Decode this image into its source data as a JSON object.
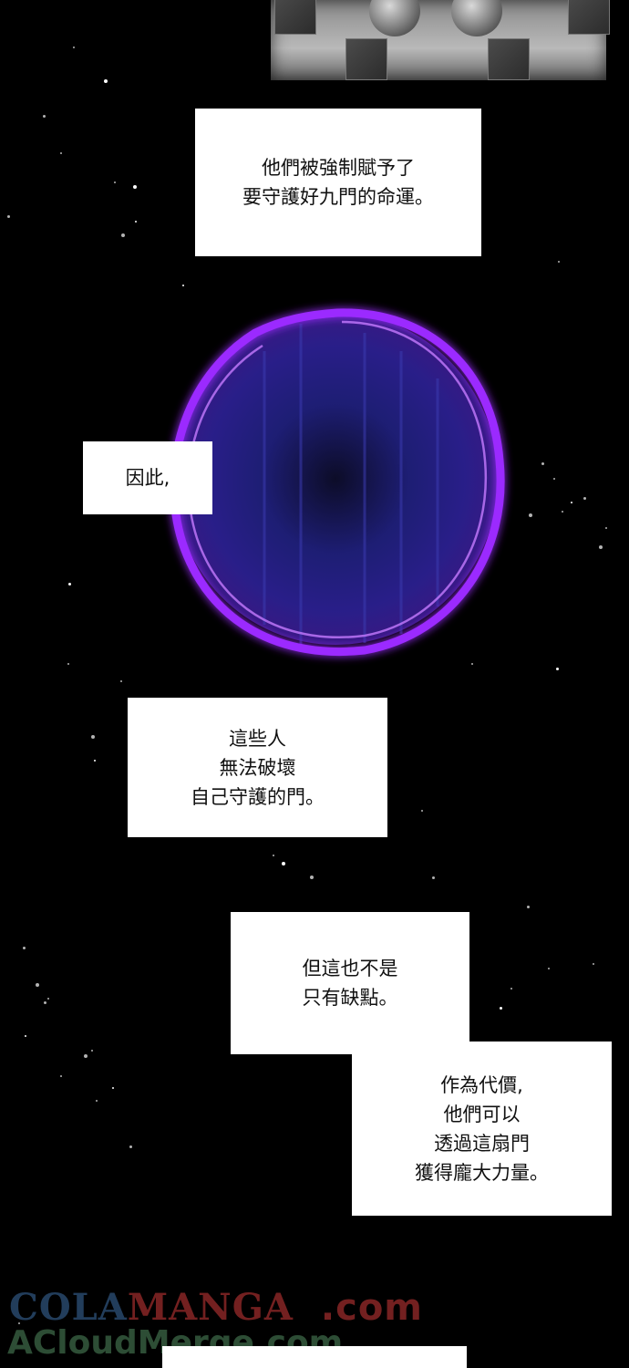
{
  "bubbles": {
    "b1": "他們被強制賦予了\n要守護好九門的命運。",
    "b2": "因此,",
    "b3": "這些人\n無法破壞\n自己守護的門。",
    "b4": "但這也不是\n只有缺點。",
    "b5": "作為代價,\n他們可以\n透過這扇門\n獲得龐大力量。"
  },
  "watermark": {
    "part1": "COLA",
    "part2": "MANGA",
    "part3": ".com",
    "line2": "ACloudMerge.com"
  },
  "colors": {
    "background": "#000000",
    "portal_rim": "#9b2cff",
    "portal_core": "#2a2a8c"
  }
}
